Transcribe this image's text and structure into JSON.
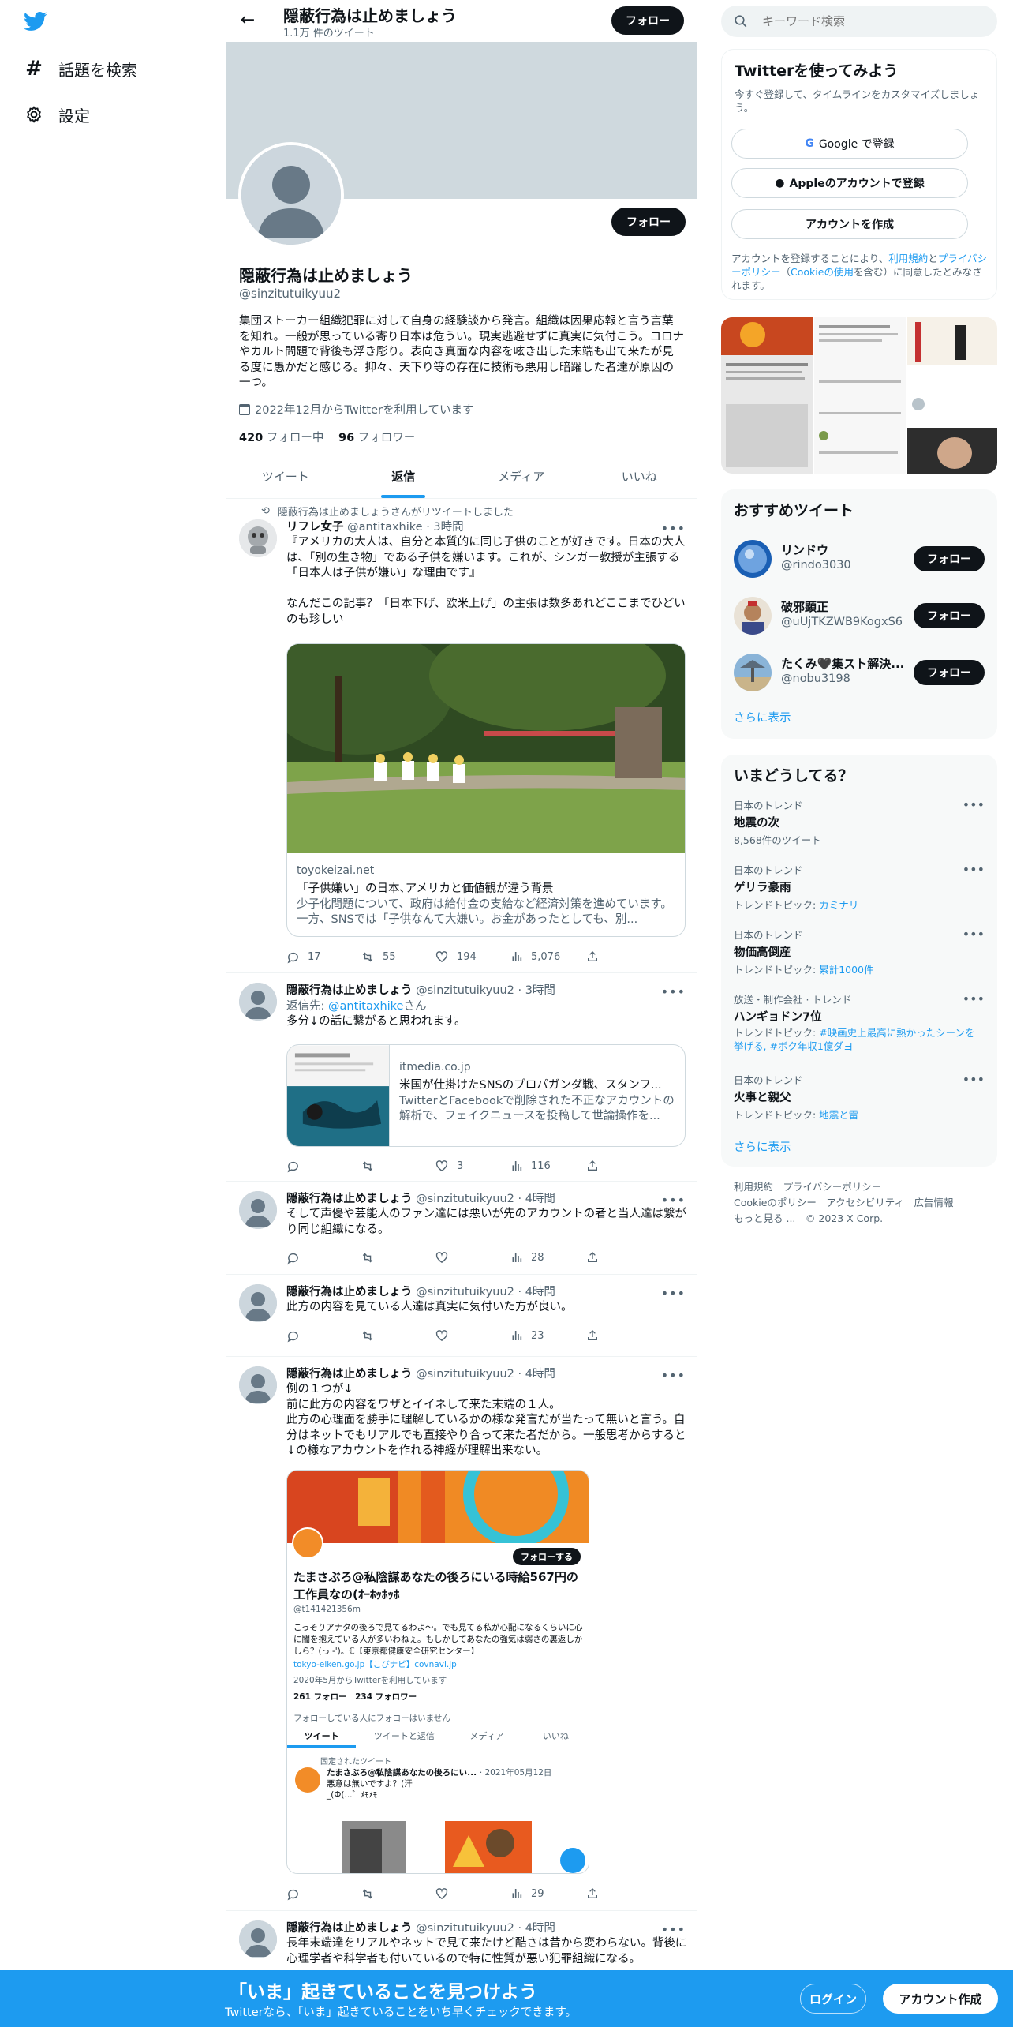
{
  "nav": {
    "explore": "話題を検索",
    "settings": "設定"
  },
  "header": {
    "title": "隠蔽行為は止めましょう",
    "tweet_count": "1.1万 件のツイート",
    "follow": "フォロー"
  },
  "profile": {
    "name": "隠蔽行為は止めましょう",
    "handle": "@sinzitutuikyuu2",
    "bio": "集団ストーカー組織犯罪に対して自身の経験談から発言。組織は因果応報と言う言葉を知れ。一般が思っている寄り日本は危うい。現実逃避せずに真実に気付こう。コロナやカルト問題で背後も浮き彫り。表向き真面な内容を呟き出した末端も出て来たが見る度に愚かだと感じる。抑々、天下り等の存在に技術も悪用し暗躍した者達が原因の一つ。",
    "joined": "2022年12月からTwitterを利用しています",
    "following_count": "420",
    "following_label": "フォロー中",
    "followers_count": "96",
    "followers_label": "フォロワー",
    "follow": "フォロー"
  },
  "tabs": [
    "ツイート",
    "返信",
    "メディア",
    "いいね"
  ],
  "tweets": [
    {
      "retweet_label": "隠蔽行為は止めましょうさんがリツイートしました",
      "name": "リフレ女子",
      "handle": "@antitaxhike",
      "time": "· 3時間",
      "text": "『アメリカの大人は、自分と本質的に同じ子供のことが好きです。日本の大人は、「別の生き物」である子供を嫌います。これが、シンガー教授が主張する「日本人は子供が嫌い」な理由です』\n\nなんだこの記事？「日本下げ、欧米上げ」の主張は数多あれどここまでひどいのも珍しい",
      "card": {
        "domain": "toyokeizai.net",
        "title": "「子供嫌い」の日本､アメリカと価値観が違う背景",
        "desc": "少子化問題について、政府は給付金の支給など経済対策を進めています。一方、SNSでは「子供なんて大嫌い。お金があったとしても、別..."
      },
      "replies": "17",
      "retweets": "55",
      "likes": "194",
      "views": "5,076"
    },
    {
      "name": "隠蔽行為は止めましょう",
      "handle": "@sinzitutuikyuu2",
      "time": "· 3時間",
      "reply_prefix": "返信先: ",
      "reply_to": "@antitaxhike",
      "reply_suffix": "さん",
      "text": "多分↓の話に繋がると思われます。",
      "card": {
        "domain": "itmedia.co.jp",
        "title": "米国が仕掛けたSNSのプロパガンダ戦、スタンフ...",
        "desc": "TwitterとFacebookで削除された不正なアカウントの解析で、フェイクニュースを投稿して世論操作を..."
      },
      "replies": "",
      "retweets": "",
      "likes": "3",
      "views": "116"
    },
    {
      "name": "隠蔽行為は止めましょう",
      "handle": "@sinzitutuikyuu2",
      "time": "· 4時間",
      "text": "そして声優や芸能人のファン達には悪いが先のアカウントの者と当人達は繋がり同じ組織になる。",
      "replies": "",
      "retweets": "",
      "likes": "",
      "views": "28"
    },
    {
      "name": "隠蔽行為は止めましょう",
      "handle": "@sinzitutuikyuu2",
      "time": "· 4時間",
      "text": "此方の内容を見ている人達は真実に気付いた方が良い。",
      "replies": "",
      "retweets": "",
      "likes": "",
      "views": "23"
    },
    {
      "name": "隠蔽行為は止めましょう",
      "handle": "@sinzitutuikyuu2",
      "time": "· 4時間",
      "text": "例の１つが↓\n前に此方の内容をワザとイイネして来た末端の１人。\n此方の心理面を勝手に理解しているかの様な発言だが当たって無いと言う。自分はネットでもリアルでも直接やり合って来た者だから。一般思考からすると↓の様なアカウントを作れる神経が理解出来ない。",
      "replies": "",
      "retweets": "",
      "likes": "",
      "views": "29",
      "embed": {
        "follow": "フォローする",
        "name": "たまさぶろ@私陰謀あなたの後ろにいる時給567円の工作員なの(ｵｰﾎｯﾎｯﾎ",
        "handle": "@t141421356m",
        "bio": "こっそりアナタの後ろで見てるわよ〜。でも見てる私が心配になるくらいに心に闇を抱えている人が多いわねぇ。もしかしてあなたの強気は弱さの裏返しかしら？(っ'-')。ℂ【東京都健康安全研究センター】",
        "links": "tokyo-eiken.go.jp【こびナビ】covnavi.jp",
        "joined": "2020年5月からTwitterを利用しています",
        "following": "261 フォロー",
        "followers": "234 フォロワー",
        "note": "フォローしている人にフォローはいません",
        "tabs": [
          "ツイート",
          "ツイートと返信",
          "メディア",
          "いいね"
        ],
        "pinned": "固定されたツイート",
        "pinned_name": "たまさぶろ@私陰謀あなたの後ろにい...",
        "pinned_date": "· 2021年05月12日",
        "pinned_text": "悪意は無いですよ？(汗\n_(Ф(...゛ﾒﾓﾒﾓ"
      }
    },
    {
      "name": "隠蔽行為は止めましょう",
      "handle": "@sinzitutuikyuu2",
      "time": "· 4時間",
      "text": "長年末端達をリアルやネットで見て来たけど酷さは昔から変わらない。背後に心理学者や科学者も付いているので特に性質が悪い犯罪組織になる。"
    }
  ],
  "right": {
    "search_placeholder": "キーワード検索",
    "signup": {
      "title": "Twitterを使ってみよう",
      "subtitle": "今すぐ登録して、タイムラインをカスタマイズしましょう。",
      "google": "Google で登録",
      "apple": "Appleのアカウントで登録",
      "create": "アカウントを作成",
      "terms_1": "アカウントを登録することにより、",
      "terms_link1": "利用規約",
      "terms_2": "と",
      "terms_link2": "プライバシーポリシー",
      "terms_3": "（",
      "terms_link3": "Cookieの使用",
      "terms_4": "を含む）に同意したとみなされます。"
    },
    "recommended": {
      "title": "おすすめツイート",
      "users": [
        {
          "name": "リンドウ",
          "handle": "@rindo3030",
          "follow": "フォロー"
        },
        {
          "name": "破邪顕正",
          "handle": "@uUjTKZWB9KogxS6",
          "follow": "フォロー"
        },
        {
          "name": "たくみ🖤集スト解決...",
          "handle": "@nobu3198",
          "follow": "フォロー"
        }
      ],
      "more": "さらに表示"
    },
    "trends": {
      "title": "いまどうしてる？",
      "items": [
        {
          "meta": "日本のトレンド",
          "name": "地震の次",
          "sub": "8,568件のツイート",
          "topic": ""
        },
        {
          "meta": "日本のトレンド",
          "name": "ゲリラ豪雨",
          "sub": "トレンドトピック: ",
          "topic": "カミナリ"
        },
        {
          "meta": "日本のトレンド",
          "name": "物価高倒産",
          "sub": "トレンドトピック: ",
          "topic": "累計1000件"
        },
        {
          "meta": "放送・制作会社 · トレンド",
          "name": "ハンギョドン7位",
          "sub": "トレンドトピック: ",
          "topic": "#映画史上最高に熱かったシーンを挙げる, #ボク年収1億ダヨ"
        },
        {
          "meta": "日本のトレンド",
          "name": "火事と親父",
          "sub": "トレンドトピック: ",
          "topic": "地震と雷"
        }
      ],
      "more": "さらに表示"
    },
    "footer": {
      "line1": "利用規約　プライバシーポリシー",
      "line2": "Cookieのポリシー　アクセシビリティ　広告情報",
      "line3": "もっと見る ...　© 2023 X Corp."
    }
  },
  "bottom": {
    "title": "「いま」起きていることを見つけよう",
    "subtitle": "Twitterなら、「いま」起きていることをいち早くチェックできます。",
    "login": "ログイン",
    "signup": "アカウント作成"
  },
  "colors": {
    "accent": "#1d9bf0",
    "text": "#0f1419",
    "muted": "#536471"
  }
}
